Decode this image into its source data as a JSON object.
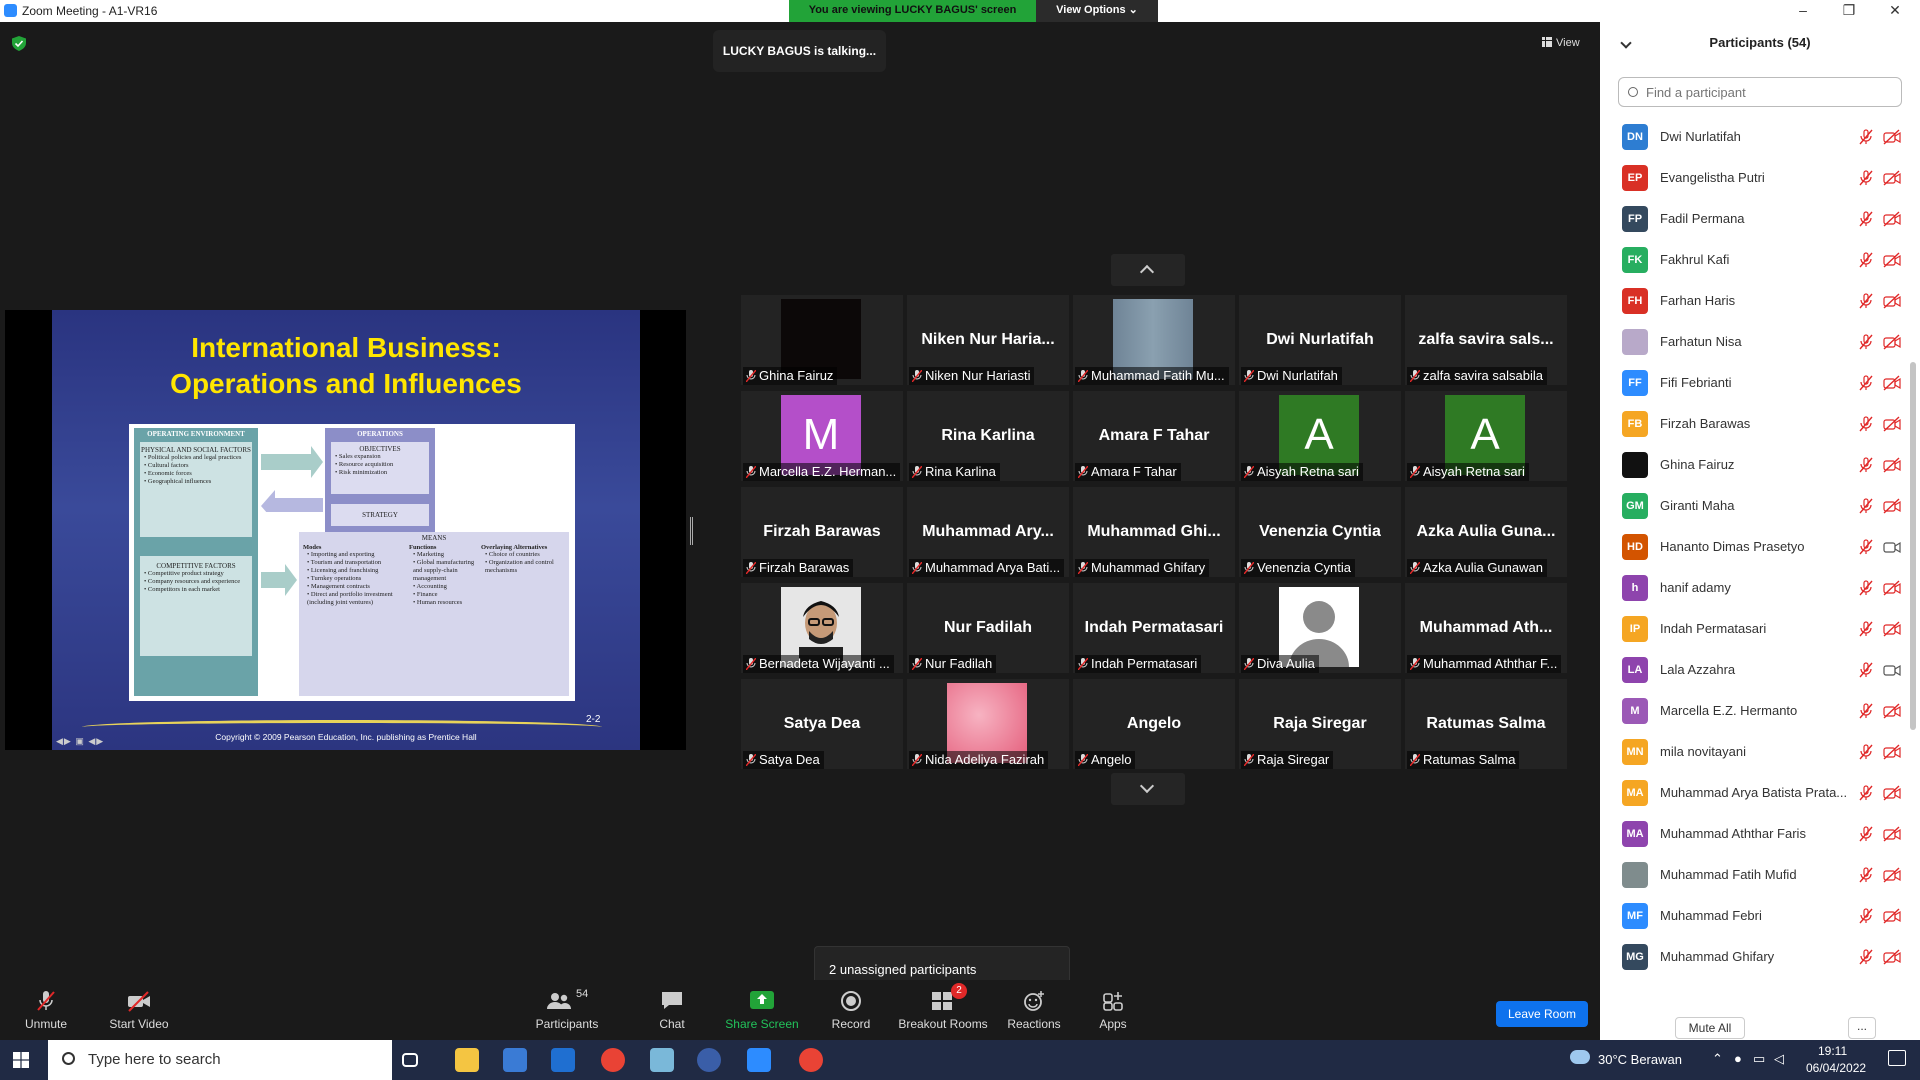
{
  "window": {
    "title": "Zoom Meeting - A1-VR16",
    "minimize": "–",
    "restore": "❐",
    "close": "✕"
  },
  "banner": {
    "viewing": "You are viewing LUCKY BAGUS' screen",
    "view_options": "View Options ⌄"
  },
  "meeting": {
    "talking": "LUCKY BAGUS is talking...",
    "view_label": "View",
    "unassigned": "2 unassigned participants"
  },
  "slide": {
    "title_line1": "International Business:",
    "title_line2": "Operations and Influences",
    "page": "2-2",
    "copyright": "Copyright © 2009 Pearson Education, Inc. publishing as Prentice Hall",
    "nav": "◀▶ ▣ ◀▶",
    "fig": {
      "env_header": "OPERATING ENVIRONMENT",
      "env_sub": "PHYSICAL AND SOCIAL FACTORS",
      "env_items": [
        "Political policies and legal practices",
        "Cultural factors",
        "Economic forces",
        "Geographical influences"
      ],
      "comp_sub": "COMPETITIVE FACTORS",
      "comp_items": [
        "Competitive product strategy",
        "Company resources and experience",
        "Competitors in each market"
      ],
      "ops_header": "OPERATIONS",
      "obj_sub": "OBJECTIVES",
      "obj_items": [
        "Sales expansion",
        "Resource acquisition",
        "Risk minimization"
      ],
      "strategy": "STRATEGY",
      "means": "MEANS",
      "modes_h": "Modes",
      "modes_items": [
        "Importing and exporting",
        "Tourism and transportation",
        "Licensing and franchising",
        "Turnkey operations",
        "Management contracts",
        "Direct and portfolio investment (including joint ventures)"
      ],
      "func_h": "Functions",
      "func_items": [
        "Marketing",
        "Global manufacturing and supply-chain management",
        "Accounting",
        "Finance",
        "Human resources"
      ],
      "alt_h": "Overlaying Alternatives",
      "alt_items": [
        "Choice of countries",
        "Organization and control mechanisms"
      ]
    }
  },
  "gallery": [
    {
      "big": "",
      "caption": "Ghina Fairuz",
      "pic": "dark"
    },
    {
      "big": "Niken Nur Haria...",
      "caption": "Niken Nur Hariasti",
      "pic": ""
    },
    {
      "big": "",
      "caption": "Muhammad Fatih Mu...",
      "pic": "grey"
    },
    {
      "big": "Dwi Nurlatifah",
      "caption": "Dwi Nurlatifah",
      "pic": ""
    },
    {
      "big": "zalfa savira sals...",
      "caption": "zalfa savira salsabila",
      "pic": ""
    },
    {
      "big": "",
      "caption": "Marcella E.Z. Herman...",
      "pic": "letterM",
      "letter": "M"
    },
    {
      "big": "Rina Karlina",
      "caption": "Rina Karlina",
      "pic": ""
    },
    {
      "big": "Amara F Tahar",
      "caption": "Amara F Tahar",
      "pic": ""
    },
    {
      "big": "",
      "caption": "Aisyah Retna sari",
      "pic": "letterA",
      "letter": "A"
    },
    {
      "big": "",
      "caption": "Aisyah Retna sari",
      "pic": "letterA",
      "letter": "A"
    },
    {
      "big": "Firzah Barawas",
      "caption": "Firzah Barawas",
      "pic": ""
    },
    {
      "big": "Muhammad Ary...",
      "caption": "Muhammad Arya Bati...",
      "pic": ""
    },
    {
      "big": "Muhammad Ghi...",
      "caption": "Muhammad Ghifary",
      "pic": ""
    },
    {
      "big": "Venenzia Cyntia",
      "caption": "Venenzia Cyntia",
      "pic": ""
    },
    {
      "big": "Azka Aulia Guna...",
      "caption": "Azka Aulia Gunawan",
      "pic": ""
    },
    {
      "big": "",
      "caption": "Bernadeta Wijayanti ...",
      "pic": "face"
    },
    {
      "big": "Nur Fadilah",
      "caption": "Nur Fadilah",
      "pic": ""
    },
    {
      "big": "Indah Permatasari",
      "caption": "Indah Permatasari",
      "pic": ""
    },
    {
      "big": "",
      "caption": "Diva Aulia",
      "pic": "avatar"
    },
    {
      "big": "Muhammad Ath...",
      "caption": "Muhammad Aththar F...",
      "pic": ""
    },
    {
      "big": "Satya Dea",
      "caption": "Satya Dea",
      "pic": ""
    },
    {
      "big": "",
      "caption": "Nida Adeliya Fazirah",
      "pic": "pink"
    },
    {
      "big": "Angelo",
      "caption": "Angelo",
      "pic": ""
    },
    {
      "big": "Raja Siregar",
      "caption": "Raja Siregar",
      "pic": ""
    },
    {
      "big": "Ratumas Salma",
      "caption": "Ratumas Salma",
      "pic": ""
    }
  ],
  "toolbar": {
    "unmute": "Unmute",
    "start_video": "Start Video",
    "participants": "Participants",
    "participants_count": "54",
    "chat": "Chat",
    "share_screen": "Share Screen",
    "record": "Record",
    "breakout_rooms": "Breakout Rooms",
    "breakout_badge": "2",
    "reactions": "Reactions",
    "apps": "Apps",
    "leave": "Leave Room"
  },
  "panel": {
    "title": "Participants (54)",
    "find_placeholder": "Find a participant",
    "mute_all": "Mute All",
    "more": "...",
    "participants": [
      {
        "initials": "DN",
        "name": "Dwi Nurlatifah",
        "color": "#2d7dd2",
        "cam": "off"
      },
      {
        "initials": "EP",
        "name": "Evangelistha Putri",
        "color": "#d93025",
        "cam": "off"
      },
      {
        "initials": "FP",
        "name": "Fadil Permana",
        "color": "#34495e",
        "cam": "off"
      },
      {
        "initials": "FK",
        "name": "Fakhrul Kafi",
        "color": "#27ae60",
        "cam": "off"
      },
      {
        "initials": "FH",
        "name": "Farhan Haris",
        "color": "#d93025",
        "cam": "off"
      },
      {
        "initials": "",
        "name": "Farhatun Nisa",
        "color": "#b8a9c9",
        "cam": "off"
      },
      {
        "initials": "FF",
        "name": "Fifi Febrianti",
        "color": "#2d8cff",
        "cam": "off"
      },
      {
        "initials": "FB",
        "name": "Firzah Barawas",
        "color": "#f5a623",
        "cam": "off"
      },
      {
        "initials": "",
        "name": "Ghina Fairuz",
        "color": "#111111",
        "cam": "off"
      },
      {
        "initials": "GM",
        "name": "Giranti Maha",
        "color": "#27ae60",
        "cam": "off"
      },
      {
        "initials": "HD",
        "name": "Hananto Dimas Prasetyo",
        "color": "#d35400",
        "cam": "on"
      },
      {
        "initials": "h",
        "name": "hanif adamy",
        "color": "#8e44ad",
        "cam": "off"
      },
      {
        "initials": "IP",
        "name": "Indah Permatasari",
        "color": "#f5a623",
        "cam": "off"
      },
      {
        "initials": "LA",
        "name": "Lala Azzahra",
        "color": "#8e44ad",
        "cam": "on"
      },
      {
        "initials": "M",
        "name": "Marcella E.Z. Hermanto",
        "color": "#9b59b6",
        "cam": "off"
      },
      {
        "initials": "MN",
        "name": "mila novitayani",
        "color": "#f5a623",
        "cam": "off"
      },
      {
        "initials": "MA",
        "name": "Muhammad Arya Batista Prata...",
        "color": "#f5a623",
        "cam": "off"
      },
      {
        "initials": "MA",
        "name": "Muhammad Aththar Faris",
        "color": "#8e44ad",
        "cam": "off"
      },
      {
        "initials": "",
        "name": "Muhammad Fatih Mufid",
        "color": "#7f8c8d",
        "cam": "off"
      },
      {
        "initials": "MF",
        "name": "Muhammad Febri",
        "color": "#2d8cff",
        "cam": "off"
      },
      {
        "initials": "MG",
        "name": "Muhammad Ghifary",
        "color": "#34495e",
        "cam": "off"
      }
    ]
  },
  "taskbar": {
    "search_placeholder": "Type here to search",
    "weather": "30°C  Berawan",
    "time": "19:11",
    "date": "06/04/2022"
  },
  "colors": {
    "accent": "#0e72ed",
    "green": "#22a338",
    "muted_red": "#e02828"
  }
}
